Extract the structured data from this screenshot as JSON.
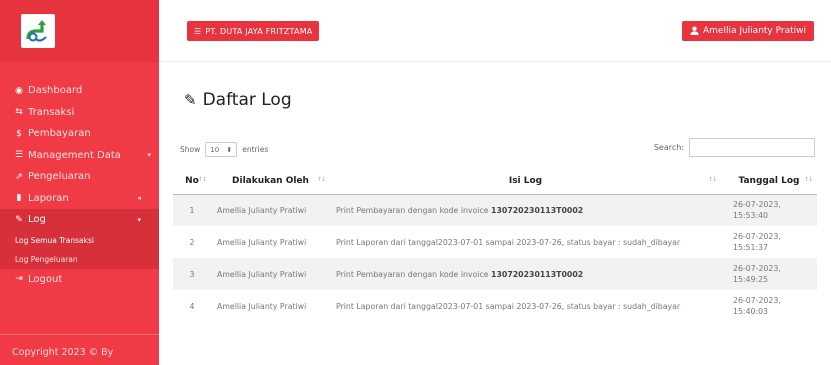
{
  "sidebar": {
    "logo": "app-logo",
    "items": [
      {
        "label": "Dashboard",
        "icon": "dashboard-icon",
        "glyph": "◉"
      },
      {
        "label": "Transaksi",
        "icon": "transaction-icon",
        "glyph": "⇆"
      },
      {
        "label": "Pembayaran",
        "icon": "dollar-icon",
        "glyph": "$"
      },
      {
        "label": "Management Data",
        "icon": "list-icon",
        "glyph": "☰",
        "caret": "▾"
      },
      {
        "label": "Pengeluaran",
        "icon": "external-icon",
        "glyph": "⇗"
      },
      {
        "label": "Laporan",
        "icon": "report-icon",
        "glyph": "▮",
        "caret": "◂"
      },
      {
        "label": "Log",
        "icon": "edit-icon",
        "glyph": "✎",
        "caret": "▾"
      },
      {
        "label": "Logout",
        "icon": "logout-icon",
        "glyph": "⇥"
      }
    ],
    "subitems": [
      {
        "label": "Log Semua Transaksi"
      },
      {
        "label": "Log Pengeluaran"
      }
    ],
    "copyright": "Copyright 2023 © By"
  },
  "topbar": {
    "company": "PT. DUTA JAYA FRITZTAMA",
    "company_icon": "☰",
    "user": "Amellia Julianty Pratiwi",
    "user_icon": "👤"
  },
  "page": {
    "title": "Daftar Log",
    "title_icon": "✎"
  },
  "table_controls": {
    "show_label": "Show",
    "entries_value": "10",
    "entries_label": "entries",
    "search_label": "Search:",
    "search_value": ""
  },
  "table": {
    "headers": [
      "No",
      "Dilakukan Oleh",
      "Isi Log",
      "Tanggal Log"
    ],
    "rows": [
      {
        "no": "1",
        "oleh": "Amellia Julianty Pratiwi",
        "isi_prefix": "Print Pembayaran dengan kode invoice ",
        "isi_bold": "130720230113T0002",
        "tanggal": "26-07-2023, 15:53:40"
      },
      {
        "no": "2",
        "oleh": "Amellia Julianty Pratiwi",
        "isi_prefix": "Print Laporan dari tanggal2023-07-01 sampai 2023-07-26, status bayar : sudah_dibayar",
        "isi_bold": "",
        "tanggal": "26-07-2023, 15:51:37"
      },
      {
        "no": "3",
        "oleh": "Amellia Julianty Pratiwi",
        "isi_prefix": "Print Pembayaran dengan kode invoice ",
        "isi_bold": "130720230113T0002",
        "tanggal": "26-07-2023, 15:49:25"
      },
      {
        "no": "4",
        "oleh": "Amellia Julianty Pratiwi",
        "isi_prefix": "Print Laporan dari tanggal2023-07-01 sampai 2023-07-26, status bayar : sudah_dibayar",
        "isi_bold": "",
        "tanggal": "26-07-2023, 15:40:03"
      }
    ]
  },
  "colors": {
    "sidebar": "#f03b46",
    "sidebar_active": "#d8303a",
    "accent": "#e8343f"
  }
}
